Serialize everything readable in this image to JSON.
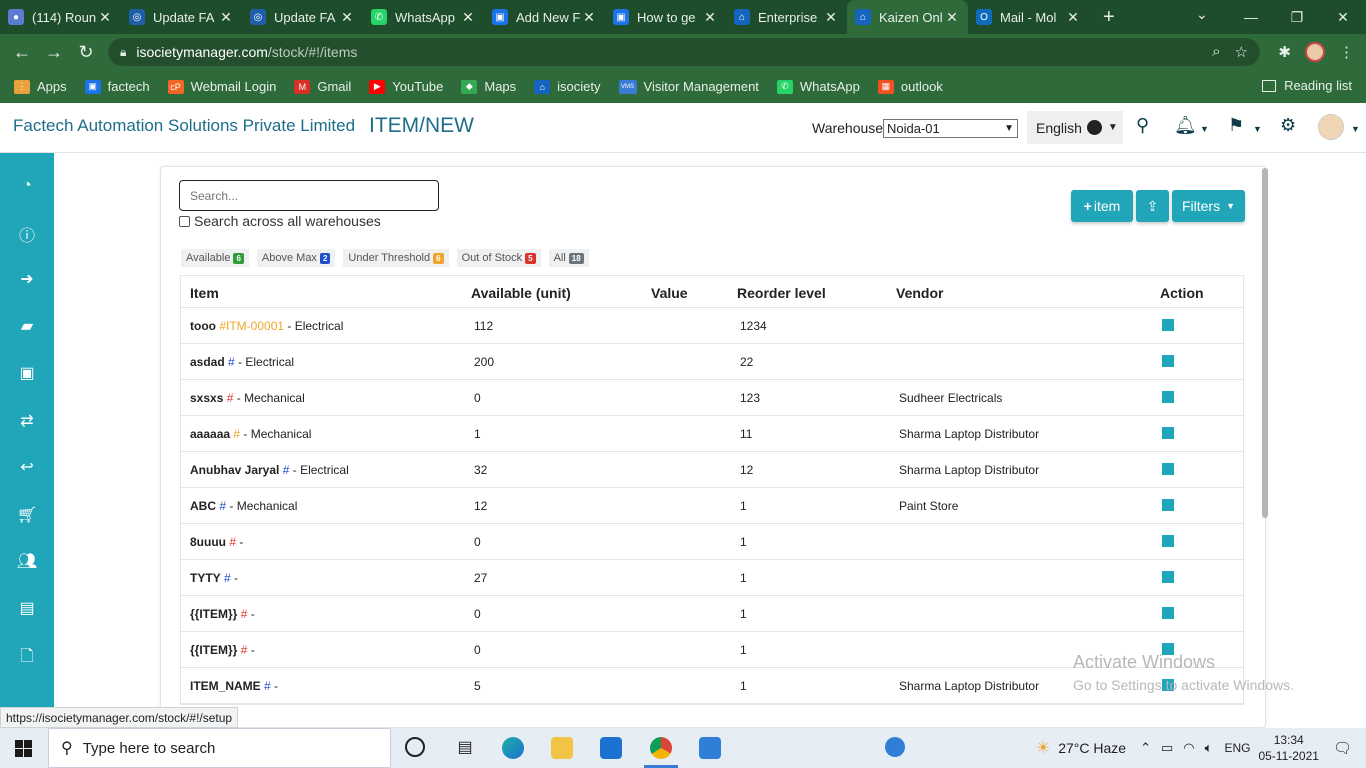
{
  "browser": {
    "tabs": [
      {
        "title": "(114) Roun",
        "fav_color": "#5b7bd5",
        "fav": "●"
      },
      {
        "title": "Update FA",
        "fav_color": "#1f5faa",
        "fav": "◎"
      },
      {
        "title": "Update FA",
        "fav_color": "#1f5faa",
        "fav": "◎"
      },
      {
        "title": "WhatsApp",
        "fav_color": "#25d366",
        "fav": "✆"
      },
      {
        "title": "Add New F",
        "fav_color": "#1a73e8",
        "fav": "▣"
      },
      {
        "title": "How to ge",
        "fav_color": "#1a73e8",
        "fav": "▣"
      },
      {
        "title": "Enterprise",
        "fav_color": "#1565c0",
        "fav": "⌂"
      },
      {
        "title": "Kaizen Onl",
        "fav_color": "#1565c0",
        "fav": "⌂"
      },
      {
        "title": "Mail - Mol",
        "fav_color": "#0f6cbd",
        "fav": "O"
      }
    ],
    "active_tab_index": 7,
    "tab_close": "✕",
    "new_tab": "+",
    "url_host": "isocietymanager.com",
    "url_path": "/stock/#!/items",
    "bookmarks": [
      {
        "label": "Apps",
        "color": "#e9a23b",
        "icon": "⋮"
      },
      {
        "label": "factech",
        "color": "#1a73e8",
        "icon": "▣"
      },
      {
        "label": "Webmail Login",
        "color": "#f26522",
        "icon": "cP"
      },
      {
        "label": "Gmail",
        "color": "#d93025",
        "icon": "M"
      },
      {
        "label": "YouTube",
        "color": "#ff0000",
        "icon": "▶"
      },
      {
        "label": "Maps",
        "color": "#34a853",
        "icon": "◆"
      },
      {
        "label": "isociety",
        "color": "#1565c0",
        "icon": "⌂"
      },
      {
        "label": "Visitor Management",
        "color": "#3a7bd5",
        "icon": "VMS"
      },
      {
        "label": "WhatsApp",
        "color": "#25d366",
        "icon": "✆"
      },
      {
        "label": "outlook",
        "color": "#f25022",
        "icon": "▦"
      }
    ],
    "reading_list": "Reading list",
    "status_url": "https://isocietymanager.com/stock/#!/setup"
  },
  "header": {
    "company": "Factech Automation Solutions Private Limited",
    "title": "ITEM/NEW",
    "warehouse_label": "Warehouse",
    "warehouse_value": "Noida-01",
    "language": "English"
  },
  "toolbar": {
    "search_placeholder": "Search...",
    "search_all_label": "Search across all warehouses",
    "add_item_label": "item",
    "filters_label": "Filters"
  },
  "filters": [
    {
      "label": "Available",
      "count": "6",
      "color": "#2e9e3b"
    },
    {
      "label": "Above Max",
      "count": "2",
      "color": "#1f4fc9"
    },
    {
      "label": "Under Threshold",
      "count": "6",
      "color": "#f0a52a"
    },
    {
      "label": "Out of Stock",
      "count": "5",
      "color": "#d9342b"
    },
    {
      "label": "All",
      "count": "18",
      "color": "#6c757d"
    }
  ],
  "table": {
    "columns": [
      "Item",
      "Available (unit)",
      "Value",
      "Reorder level",
      "Vendor",
      "Action"
    ],
    "rows": [
      {
        "name": "tooo",
        "hash": "#ITM-00001",
        "hash_type": "code",
        "category": " - Electrical",
        "available": "112",
        "value": "",
        "reorder": "1234",
        "vendor": ""
      },
      {
        "name": "asdad",
        "hash": "#",
        "hash_type": "blue",
        "category": " - Electrical",
        "available": "200",
        "value": "",
        "reorder": "22",
        "vendor": ""
      },
      {
        "name": "sxsxs",
        "hash": "#",
        "hash_type": "red",
        "category": " - Mechanical",
        "available": "0",
        "value": "",
        "reorder": "123",
        "vendor": "Sudheer Electricals"
      },
      {
        "name": "aaaaaa",
        "hash": "#",
        "hash_type": "code",
        "category": " - Mechanical",
        "available": "1",
        "value": "",
        "reorder": "11",
        "vendor": "Sharma Laptop Distributor"
      },
      {
        "name": "Anubhav Jaryal",
        "hash": "#",
        "hash_type": "blue",
        "category": " - Electrical",
        "available": "32",
        "value": "",
        "reorder": "12",
        "vendor": "Sharma Laptop Distributor"
      },
      {
        "name": "ABC",
        "hash": "#",
        "hash_type": "blue",
        "category": " - Mechanical",
        "available": "12",
        "value": "",
        "reorder": "1",
        "vendor": "Paint Store"
      },
      {
        "name": "8uuuu",
        "hash": "#",
        "hash_type": "red",
        "category": " -",
        "available": "0",
        "value": "",
        "reorder": "1",
        "vendor": ""
      },
      {
        "name": "TYTY",
        "hash": "#",
        "hash_type": "blue",
        "category": " -",
        "available": "27",
        "value": "",
        "reorder": "1",
        "vendor": ""
      },
      {
        "name": "{{ITEM}}",
        "hash": "#",
        "hash_type": "red",
        "category": " -",
        "available": "0",
        "value": "",
        "reorder": "1",
        "vendor": ""
      },
      {
        "name": "{{ITEM}}",
        "hash": "#",
        "hash_type": "red",
        "category": " -",
        "available": "0",
        "value": "",
        "reorder": "1",
        "vendor": ""
      },
      {
        "name": "ITEM_NAME",
        "hash": "#",
        "hash_type": "blue",
        "category": " -",
        "available": "5",
        "value": "",
        "reorder": "1",
        "vendor": "Sharma Laptop Distributor"
      }
    ]
  },
  "watermark": {
    "line1": "Activate Windows",
    "line2": "Go to Settings to activate Windows."
  },
  "taskbar": {
    "search_placeholder": "Type here to search",
    "weather": "27°C  Haze",
    "lang": "ENG",
    "time": "13:34",
    "date": "05-11-2021"
  }
}
